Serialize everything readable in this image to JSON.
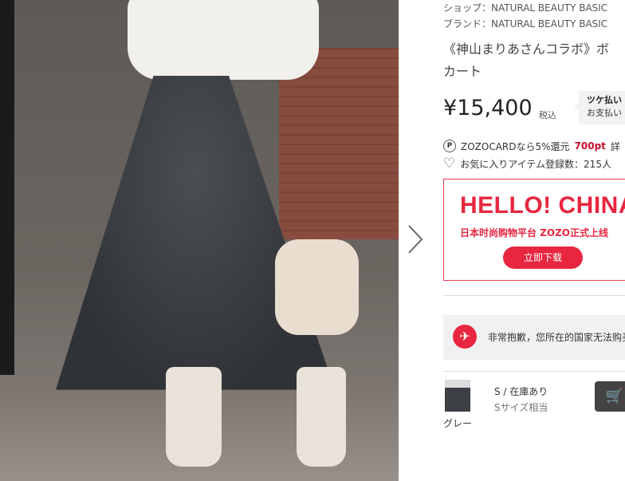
{
  "shop_line": "ショップ：NATURAL BEAUTY BASIC",
  "brand_line": "ブランド：NATURAL BEAUTY BASIC",
  "title_line1": "《神山まりあさんコラボ》ボ",
  "title_line2": "カート",
  "price": "¥15,400",
  "tax_label": "税込",
  "tsuke": {
    "line1": "ツケ払い",
    "line2": "お支払い"
  },
  "points": {
    "icon": "P",
    "text": "ZOZOCARDなら5%還元",
    "amount": "700pt",
    "suffix": "詳"
  },
  "favorite": {
    "text": "お気に入りアイテム登録数：215人"
  },
  "banner": {
    "title": "HELLO! CHINA",
    "subtitle": "日本时尚购物平台 ZOZO正式上线",
    "button": "立即下载"
  },
  "notice": {
    "text": "非常抱歉，您所在的国家无法购买"
  },
  "sku": {
    "color": "グレー",
    "size": "S / 在庫あり",
    "equiv": "Sサイズ相当"
  },
  "colors": {
    "accent": "#e8263f",
    "points": "#c8102e"
  },
  "icons": {
    "next": "chevron-right-icon",
    "heart": "heart-icon",
    "cart": "cart-icon",
    "points": "points-icon",
    "blocked": "blocked-icon"
  }
}
